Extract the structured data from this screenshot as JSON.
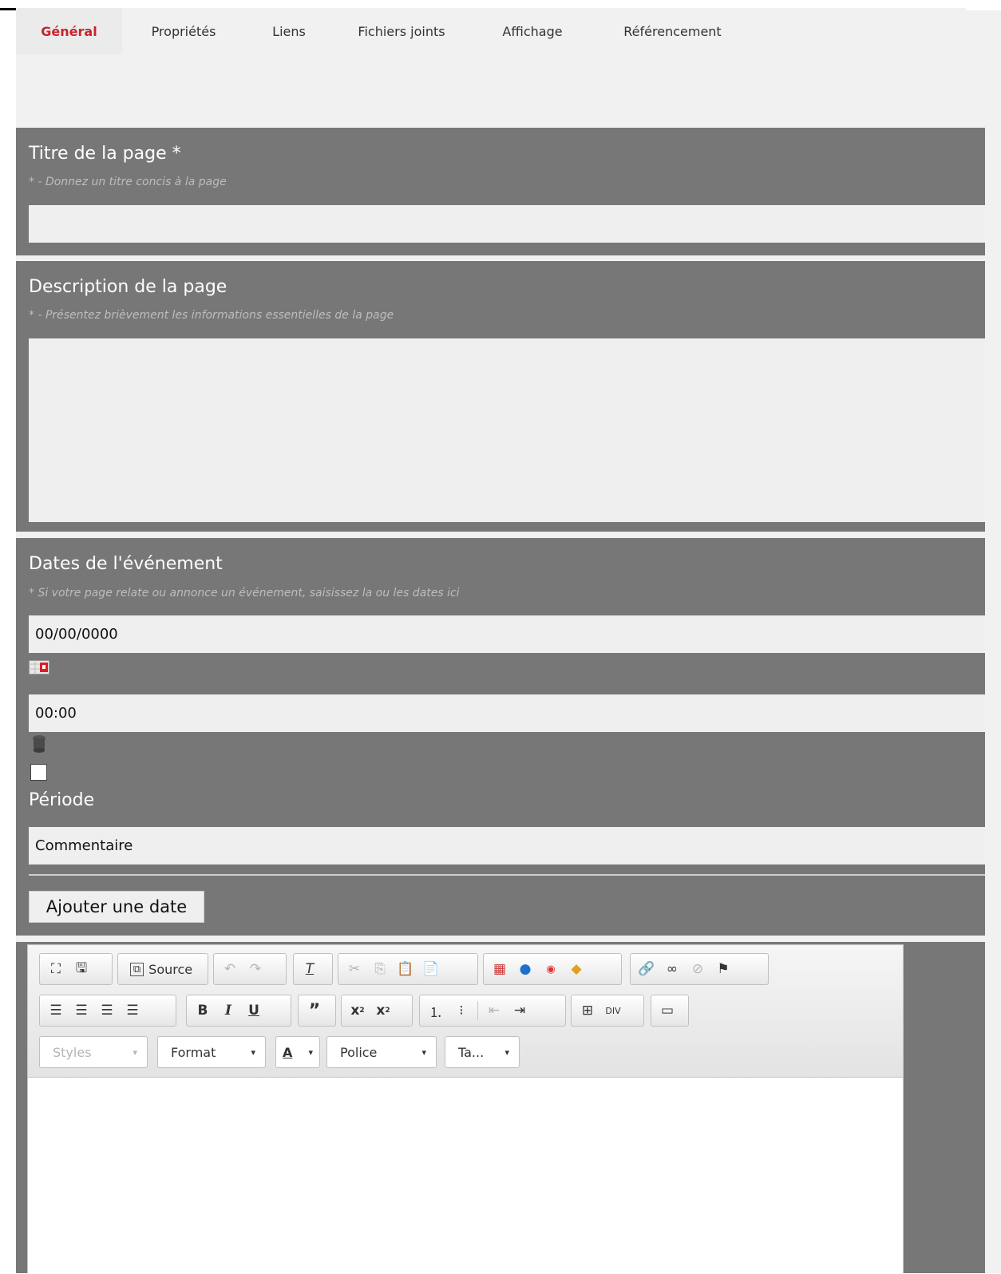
{
  "tabs": [
    {
      "label": "Général",
      "active": true
    },
    {
      "label": "Propriétés"
    },
    {
      "label": "Liens"
    },
    {
      "label": "Fichiers joints"
    },
    {
      "label": "Affichage"
    },
    {
      "label": "Référencement"
    }
  ],
  "title_section": {
    "title": "Titre de la page *",
    "hint": "* - Donnez un titre concis à la page",
    "value": ""
  },
  "description_section": {
    "title": "Description de la page",
    "hint": "* - Présentez brièvement les informations essentielles de la page",
    "value": ""
  },
  "dates_section": {
    "title": "Dates de l'événement",
    "hint": "* Si votre page relate ou annonce un événement, saisissez la ou les dates ici",
    "date_value": "00/00/0000",
    "time_value": "00:00",
    "period_label": "Période",
    "comment_placeholder": "Commentaire",
    "add_date_button": "Ajouter une date"
  },
  "editor": {
    "source_label": "Source",
    "styles_label": "Styles",
    "format_label": "Format",
    "font_label": "Police",
    "size_label": "Ta..."
  },
  "colors": {
    "panel_bg": "#777777",
    "active_tab": "#c7252b",
    "field_bg": "#efefef"
  }
}
